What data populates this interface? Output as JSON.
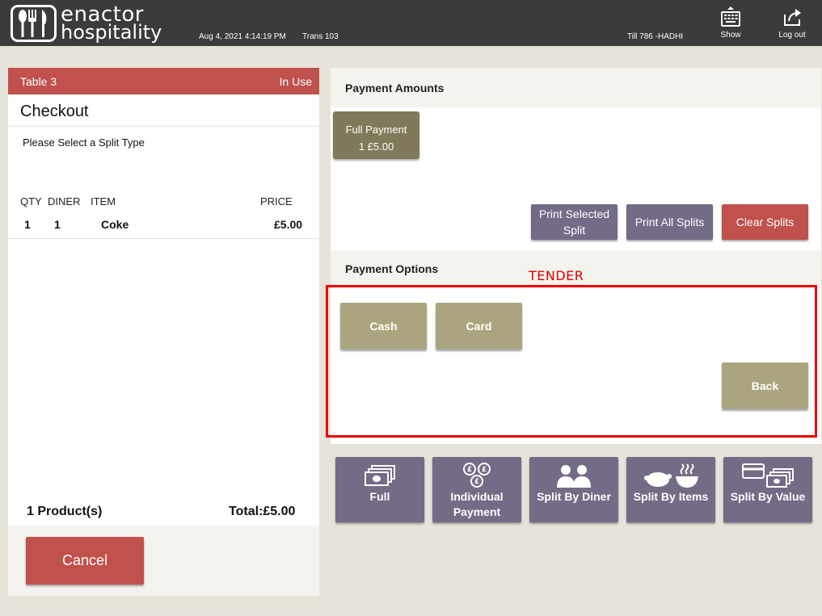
{
  "header": {
    "logo_line1": "enactor",
    "logo_line2": "hospitality",
    "datetime": "Aug 4, 2021 4:14:19 PM",
    "trans": "Trans 103",
    "till": "Till 786 -HADHI",
    "show_label": "Show",
    "logout_label": "Log out"
  },
  "order": {
    "table_name": "Table 3",
    "table_status": "In Use",
    "title": "Checkout",
    "prompt": "Please Select a Split Type",
    "columns": [
      "QTY",
      "DINER",
      "ITEM",
      "PRICE"
    ],
    "items": [
      {
        "qty": "1",
        "diner": "1",
        "item": "Coke",
        "price": "£5.00"
      }
    ],
    "product_count": "1 Product(s)",
    "total": "Total:£5.00",
    "cancel_label": "Cancel"
  },
  "payment_amounts": {
    "title": "Payment Amounts",
    "full_payment_line1": "Full Payment",
    "full_payment_line2": "1 £5.00",
    "print_selected_line1": "Print Selected",
    "print_selected_line2": "Split",
    "print_all": "Print All Splits",
    "clear": "Clear Splits"
  },
  "payment_options": {
    "title": "Payment Options",
    "annotation": "TENDER",
    "cash": "Cash",
    "card": "Card",
    "back": "Back"
  },
  "split_types": [
    {
      "line1": "",
      "line2": "Full",
      "icon": "banknotes-icon"
    },
    {
      "line1": "Individual",
      "line2": "Payment",
      "icon": "coins-icon"
    },
    {
      "line1": "",
      "line2": "Split By Diner",
      "icon": "diners-icon"
    },
    {
      "line1": "",
      "line2": "Split By Items",
      "icon": "food-items-icon"
    },
    {
      "line1": "",
      "line2": "Split By Value",
      "icon": "card-and-cash-icon"
    }
  ],
  "colors": {
    "header_bg": "#3b3b3b",
    "accent_red": "#c0514d",
    "purple": "#746b86",
    "khaki": "#aba57f",
    "olive": "#807a5a",
    "annotation_red": "#ee0000"
  }
}
